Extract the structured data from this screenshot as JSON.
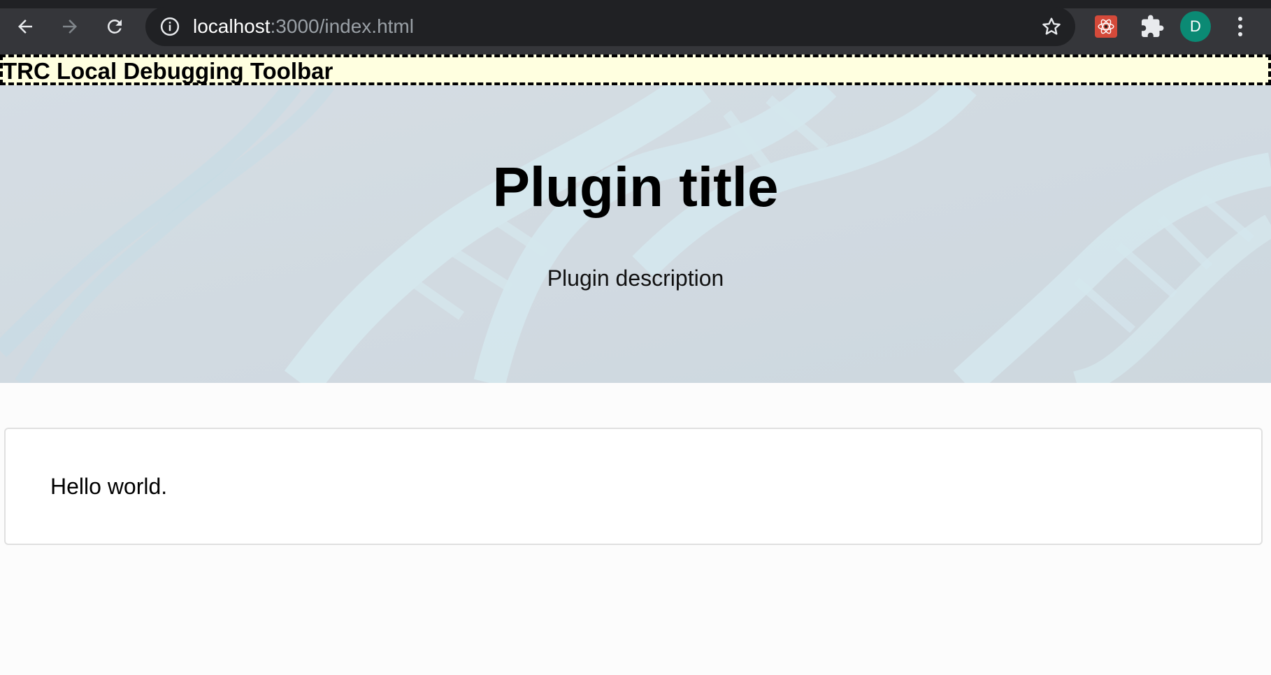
{
  "browser": {
    "url_host": "localhost",
    "url_path": ":3000/index.html",
    "profile_initial": "D",
    "colors": {
      "chrome_bg": "#35363a",
      "omnibox_bg": "#202124",
      "avatar_bg": "#0b8a74",
      "react_ext_bg": "#d44a3a"
    },
    "icons": [
      "back-arrow-icon",
      "forward-arrow-icon",
      "reload-icon",
      "info-icon",
      "star-icon",
      "react-devtools-icon",
      "puzzle-icon",
      "menu-dots-icon"
    ]
  },
  "debug_toolbar": {
    "label": "TRC Local Debugging Toolbar",
    "bg_color": "#ffffe0"
  },
  "hero": {
    "title": "Plugin title",
    "description": "Plugin description"
  },
  "card": {
    "text": "Hello world."
  }
}
